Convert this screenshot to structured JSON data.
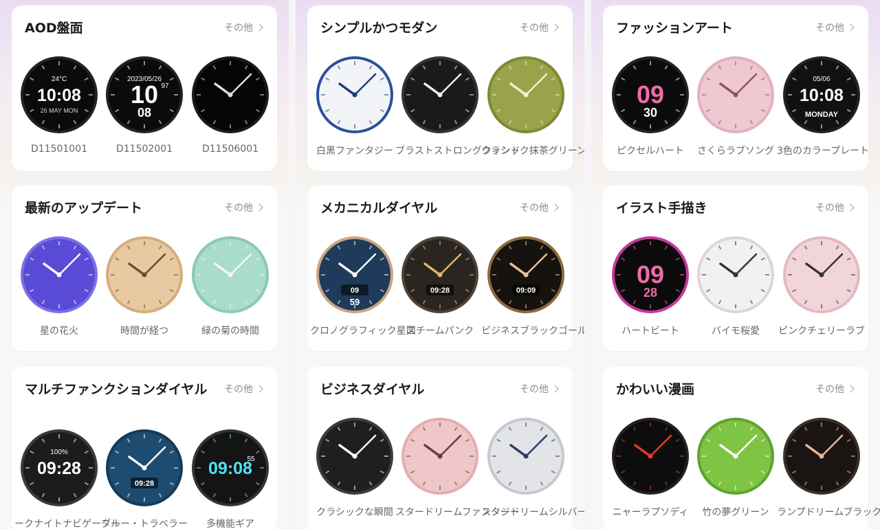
{
  "columns": [
    {
      "cards": [
        {
          "title": "AOD盤面",
          "more": "その他",
          "faces": [
            {
              "label": "D11501001",
              "time": "10:08",
              "small": "24°C",
              "date": "26 MAY MON",
              "style": "aod1"
            },
            {
              "label": "D11502001",
              "time": "10",
              "small": "2023/05/26",
              "sub": "08",
              "extra": "97",
              "style": "aod2"
            },
            {
              "label": "D11506001",
              "style": "aod3"
            }
          ]
        },
        {
          "title": "最新のアップデート",
          "more": "その他",
          "faces": [
            {
              "label": "星の花火",
              "style": "purple"
            },
            {
              "label": "時間が経つ",
              "style": "gold"
            },
            {
              "label": "緑の菊の時間",
              "style": "mint"
            }
          ]
        },
        {
          "title": "マルチファンクションダイヤル",
          "more": "その他",
          "faces": [
            {
              "label": "ークナイトナビゲーター",
              "time": "09:28",
              "small": "100%",
              "style": "darkdigital"
            },
            {
              "label": "ブルー・トラベラー",
              "time": "09:28",
              "style": "bluetravel"
            },
            {
              "label": "多機能ギア",
              "time": "09:08",
              "extra": "55",
              "style": "neon"
            }
          ]
        }
      ]
    },
    {
      "cards": [
        {
          "title": "シンプルかつモダン",
          "more": "その他",
          "faces": [
            {
              "label": "白黒ファンタジー",
              "style": "whiteblue"
            },
            {
              "label": "ブラストストロングウィンド",
              "style": "darkring"
            },
            {
              "label": "クラシック抹茶グリーン",
              "style": "olive"
            }
          ]
        },
        {
          "title": "メカニカルダイヤル",
          "more": "その他",
          "faces": [
            {
              "label": "クロノグラフィック星図",
              "time": "09",
              "sub": "59",
              "style": "chrono"
            },
            {
              "label": "スチームパンク",
              "time": "09:28",
              "style": "steam"
            },
            {
              "label": "ビジネスブラックゴールド",
              "time": "09:09",
              "style": "bizgold"
            }
          ]
        },
        {
          "title": "ビジネスダイヤル",
          "more": "その他",
          "faces": [
            {
              "label": "クラシックな瞬間",
              "style": "classic"
            },
            {
              "label": "スタードリームファンタジー",
              "style": "pinkstar"
            },
            {
              "label": "スタードリームシルバー",
              "style": "silverstar"
            }
          ]
        }
      ]
    },
    {
      "cards": [
        {
          "title": "ファッションアート",
          "more": "その他",
          "faces": [
            {
              "label": "ピクセルハート",
              "time": "09",
              "sub": "30",
              "style": "pixel"
            },
            {
              "label": "さくらラブソング",
              "style": "sakura"
            },
            {
              "label": "3色のカラープレート",
              "time": "10:08",
              "small": "05/06",
              "sub": "MONDAY",
              "style": "tricolor"
            }
          ]
        },
        {
          "title": "イラスト手描き",
          "more": "その他",
          "faces": [
            {
              "label": "ハートビート",
              "time": "09",
              "sub": "28",
              "style": "heartbeat"
            },
            {
              "label": "バイモ桜愛",
              "style": "whitesakura"
            },
            {
              "label": "ピンクチェリーラブ",
              "style": "pinkcherry"
            }
          ]
        },
        {
          "title": "かわいい漫画",
          "more": "その他",
          "faces": [
            {
              "label": "ニャーラプソディ",
              "style": "cat"
            },
            {
              "label": "竹の夢グリーン",
              "style": "bamboo"
            },
            {
              "label": "ランプドリームブラック",
              "style": "roman"
            }
          ]
        }
      ]
    }
  ]
}
